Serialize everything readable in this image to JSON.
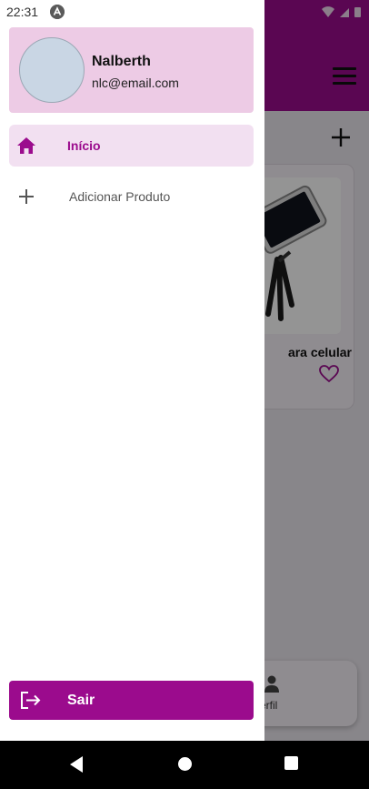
{
  "status_bar": {
    "time": "22:31"
  },
  "drawer": {
    "user": {
      "name": "Nalberth",
      "email": "nlc@email.com"
    },
    "items": [
      {
        "label": "Início",
        "icon": "home-icon",
        "active": true
      },
      {
        "label": "Adicionar Produto",
        "icon": "plus-icon",
        "active": false
      }
    ],
    "logout": {
      "label": "Sair",
      "icon": "logout-icon"
    }
  },
  "background_app": {
    "product": {
      "name_fragment": "ara celular"
    },
    "bottom_nav": {
      "profile_label_fragment": "erfil"
    }
  },
  "colors": {
    "primary": "#9b0b8d",
    "header_bg": "#edcbe5",
    "active_item_bg": "#f2e0f1"
  }
}
